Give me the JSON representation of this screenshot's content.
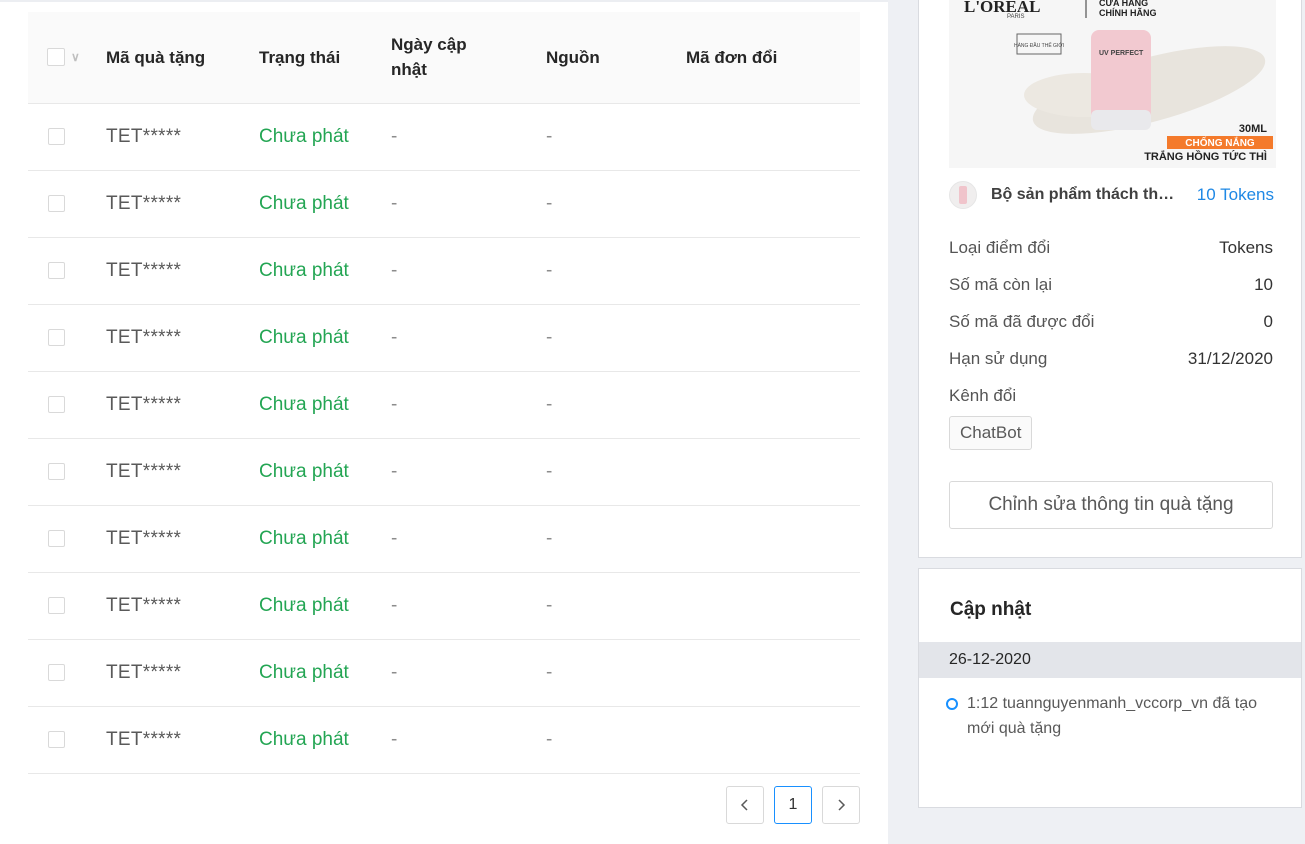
{
  "table": {
    "columns": [
      "Mã quà tặng",
      "Trạng thái",
      "Ngày cập nhật",
      "Nguồn",
      "Mã đơn đổi"
    ],
    "rows": [
      {
        "code": "TET*****",
        "status": "Chưa phát",
        "date": "-",
        "source": "-",
        "order": ""
      },
      {
        "code": "TET*****",
        "status": "Chưa phát",
        "date": "-",
        "source": "-",
        "order": ""
      },
      {
        "code": "TET*****",
        "status": "Chưa phát",
        "date": "-",
        "source": "-",
        "order": ""
      },
      {
        "code": "TET*****",
        "status": "Chưa phát",
        "date": "-",
        "source": "-",
        "order": ""
      },
      {
        "code": "TET*****",
        "status": "Chưa phát",
        "date": "-",
        "source": "-",
        "order": ""
      },
      {
        "code": "TET*****",
        "status": "Chưa phát",
        "date": "-",
        "source": "-",
        "order": ""
      },
      {
        "code": "TET*****",
        "status": "Chưa phát",
        "date": "-",
        "source": "-",
        "order": ""
      },
      {
        "code": "TET*****",
        "status": "Chưa phát",
        "date": "-",
        "source": "-",
        "order": ""
      },
      {
        "code": "TET*****",
        "status": "Chưa phát",
        "date": "-",
        "source": "-",
        "order": ""
      },
      {
        "code": "TET*****",
        "status": "Chưa phát",
        "date": "-",
        "source": "-",
        "order": ""
      }
    ]
  },
  "pagination": {
    "current_page": "1"
  },
  "product_image": {
    "brand": "L'ORÉAL",
    "brand_sub": "PARIS",
    "store_line1": "CỬA HÀNG",
    "store_line2": "CHÍNH HÃNG",
    "badge": "HÀNG ĐẦU THẾ GIỚI",
    "product_line": "UV PERFECT",
    "volume": "30ML",
    "ribbon": "CHỐNG NẮNG",
    "slogan": "TRẮNG HỒNG TỨC THÌ"
  },
  "gift": {
    "name": "Bộ sản phẩm thách thức tuổi tác",
    "tokens": "10 Tokens",
    "details": [
      {
        "label": "Loại điểm đổi",
        "value": "Tokens"
      },
      {
        "label": "Số mã còn lại",
        "value": "10"
      },
      {
        "label": "Số mã đã được đổi",
        "value": "0"
      },
      {
        "label": "Hạn sử dụng",
        "value": "31/12/2020"
      }
    ],
    "channel_label": "Kênh đổi",
    "channel_tag": "ChatBot",
    "edit_button": "Chỉnh sửa thông tin quà tặng"
  },
  "updates": {
    "title": "Cập nhật",
    "date": "26-12-2020",
    "entries": [
      {
        "text": "1:12 tuannguyenmanh_vccorp_vn đã tạo mới quà tặng"
      }
    ]
  },
  "colors": {
    "status_green": "#23a553",
    "link_blue": "#1e88e5",
    "accent_blue": "#1890ff"
  }
}
